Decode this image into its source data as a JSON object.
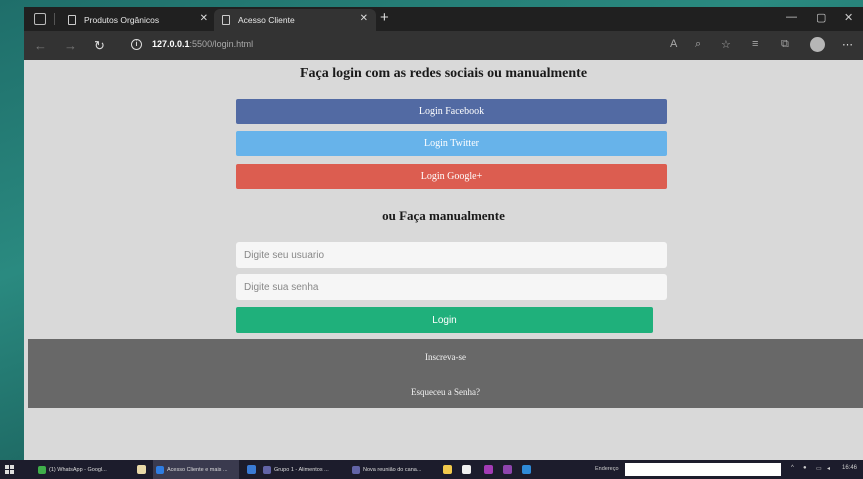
{
  "browser": {
    "tabs": [
      {
        "label": "Produtos Orgânicos",
        "close": "✕"
      },
      {
        "label": "Acesso Cliente",
        "close": "✕"
      }
    ],
    "new_tab": "+",
    "window_controls": {
      "minimize": "—",
      "maximize": "▢",
      "close": "✕"
    },
    "url_host": "127.0.0.1",
    "url_rest": ":5500/login.html",
    "icons": [
      "back-icon",
      "forward-icon",
      "refresh-icon",
      "info-icon",
      "read-aloud-icon",
      "zoom-icon",
      "favorite-icon",
      "favorites-icon",
      "collections-icon",
      "profile-icon",
      "more-icon"
    ]
  },
  "page": {
    "heading": "Faça login com as redes sociais ou manualmente",
    "social": {
      "facebook": "Login Facebook",
      "twitter": "Login Twitter",
      "google": "Login Google+"
    },
    "manual_heading": "ou Faça manualmente",
    "username_placeholder": "Digite seu usuario",
    "password_placeholder": "Digite sua senha",
    "login_button": "Login",
    "footer": {
      "signup": "Inscreva-se",
      "forgot": "Esqueceu a Senha?"
    },
    "colors": {
      "facebook": "#526aa3",
      "twitter": "#67b3ea",
      "google": "#dc5d50",
      "login": "#1fb07b",
      "footer": "#686868"
    }
  },
  "taskbar": {
    "items": [
      {
        "label": "(1) WhatsApp - Googl...",
        "color": "#3fae4a"
      },
      {
        "label": "Acesso Cliente e mais ...",
        "color": "#2f7de1"
      },
      {
        "label": "Grupo 1 - Alimentos ...",
        "color": "#6264a7"
      },
      {
        "label": "Nova reunião do cana...",
        "color": "#6264a7"
      }
    ],
    "address_label": "Endereço",
    "clock": "16:46"
  }
}
